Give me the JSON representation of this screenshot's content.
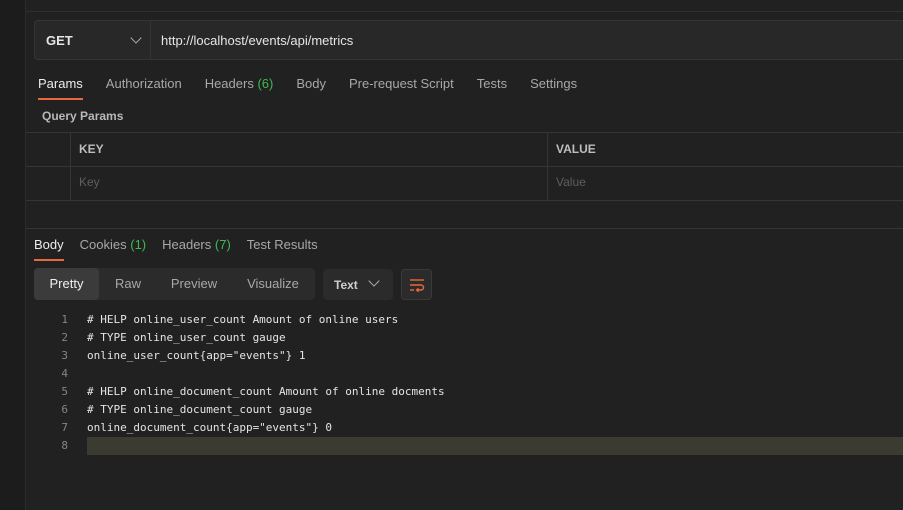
{
  "request": {
    "method": "GET",
    "url": "http://localhost/events/api/metrics"
  },
  "request_tabs": [
    {
      "label": "Params"
    },
    {
      "label": "Authorization"
    },
    {
      "label": "Headers",
      "count": "(6)"
    },
    {
      "label": "Body"
    },
    {
      "label": "Pre-request Script"
    },
    {
      "label": "Tests"
    },
    {
      "label": "Settings"
    }
  ],
  "query_params": {
    "title": "Query Params",
    "key_header": "KEY",
    "value_header": "VALUE",
    "key_placeholder": "Key",
    "value_placeholder": "Value"
  },
  "response_tabs": [
    {
      "label": "Body"
    },
    {
      "label": "Cookies",
      "count": "(1)"
    },
    {
      "label": "Headers",
      "count": "(7)"
    },
    {
      "label": "Test Results"
    }
  ],
  "view_modes": [
    "Pretty",
    "Raw",
    "Preview",
    "Visualize"
  ],
  "format": "Text",
  "code_lines": [
    {
      "n": "1",
      "text": "# HELP online_user_count Amount of online users"
    },
    {
      "n": "2",
      "text": "# TYPE online_user_count gauge"
    },
    {
      "n": "3",
      "text": "online_user_count{app=\"events\"} 1"
    },
    {
      "n": "4",
      "text": ""
    },
    {
      "n": "5",
      "text": "# HELP online_document_count Amount of online docments"
    },
    {
      "n": "6",
      "text": "# TYPE online_document_count gauge"
    },
    {
      "n": "7",
      "text": "online_document_count{app=\"events\"} 0"
    },
    {
      "n": "8",
      "text": ""
    }
  ],
  "colors": {
    "accent": "#e8693e",
    "count": "#3fb950",
    "current_line": "#3c3b32"
  },
  "icons": {
    "method_dropdown": "chevron-down-icon",
    "format_dropdown": "chevron-down-icon",
    "wrap": "wrap-lines-icon"
  }
}
